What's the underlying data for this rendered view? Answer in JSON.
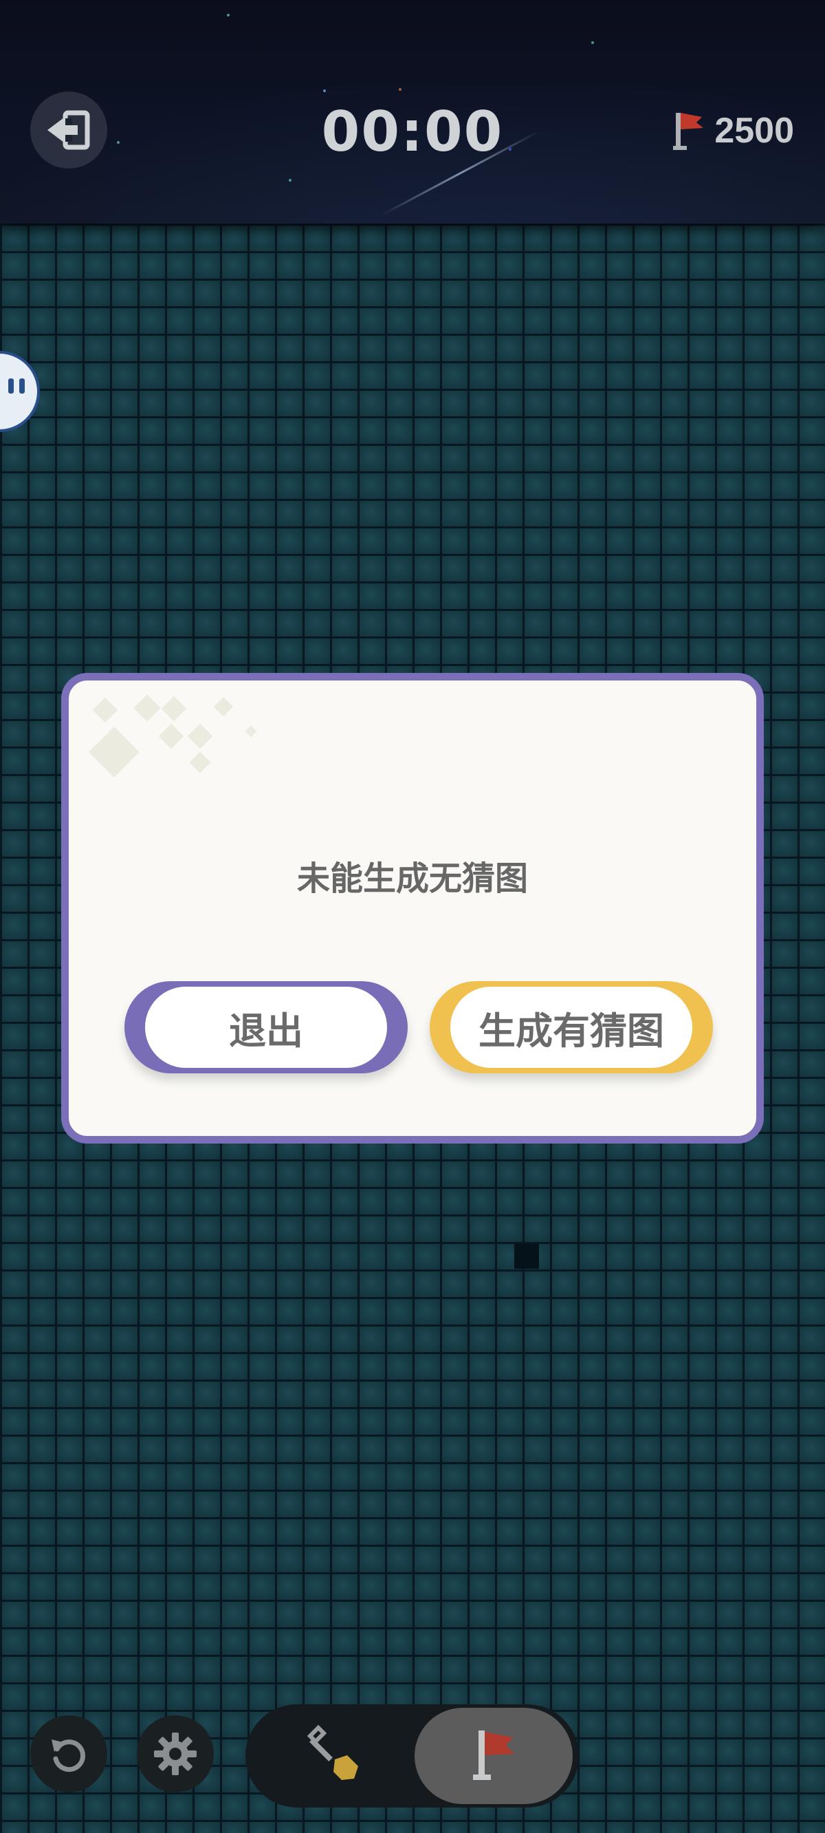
{
  "header": {
    "timer": "00:00",
    "flag_count": "2500"
  },
  "dialog": {
    "message": "未能生成无猜图",
    "exit_label": "退出",
    "generate_label": "生成有猜图"
  },
  "controls": {
    "undo_icon": "undo-icon",
    "settings_icon": "gear-icon",
    "dig_mode_icon": "shovel-icon",
    "flag_mode_icon": "flag-icon",
    "selected_mode": "flag"
  },
  "colors": {
    "dialog_border": "#7c6fb9",
    "exit_button": "#7a6db7",
    "generate_button": "#f0c14e",
    "flag_red": "#c0392b",
    "board_cell": "#163a44"
  }
}
